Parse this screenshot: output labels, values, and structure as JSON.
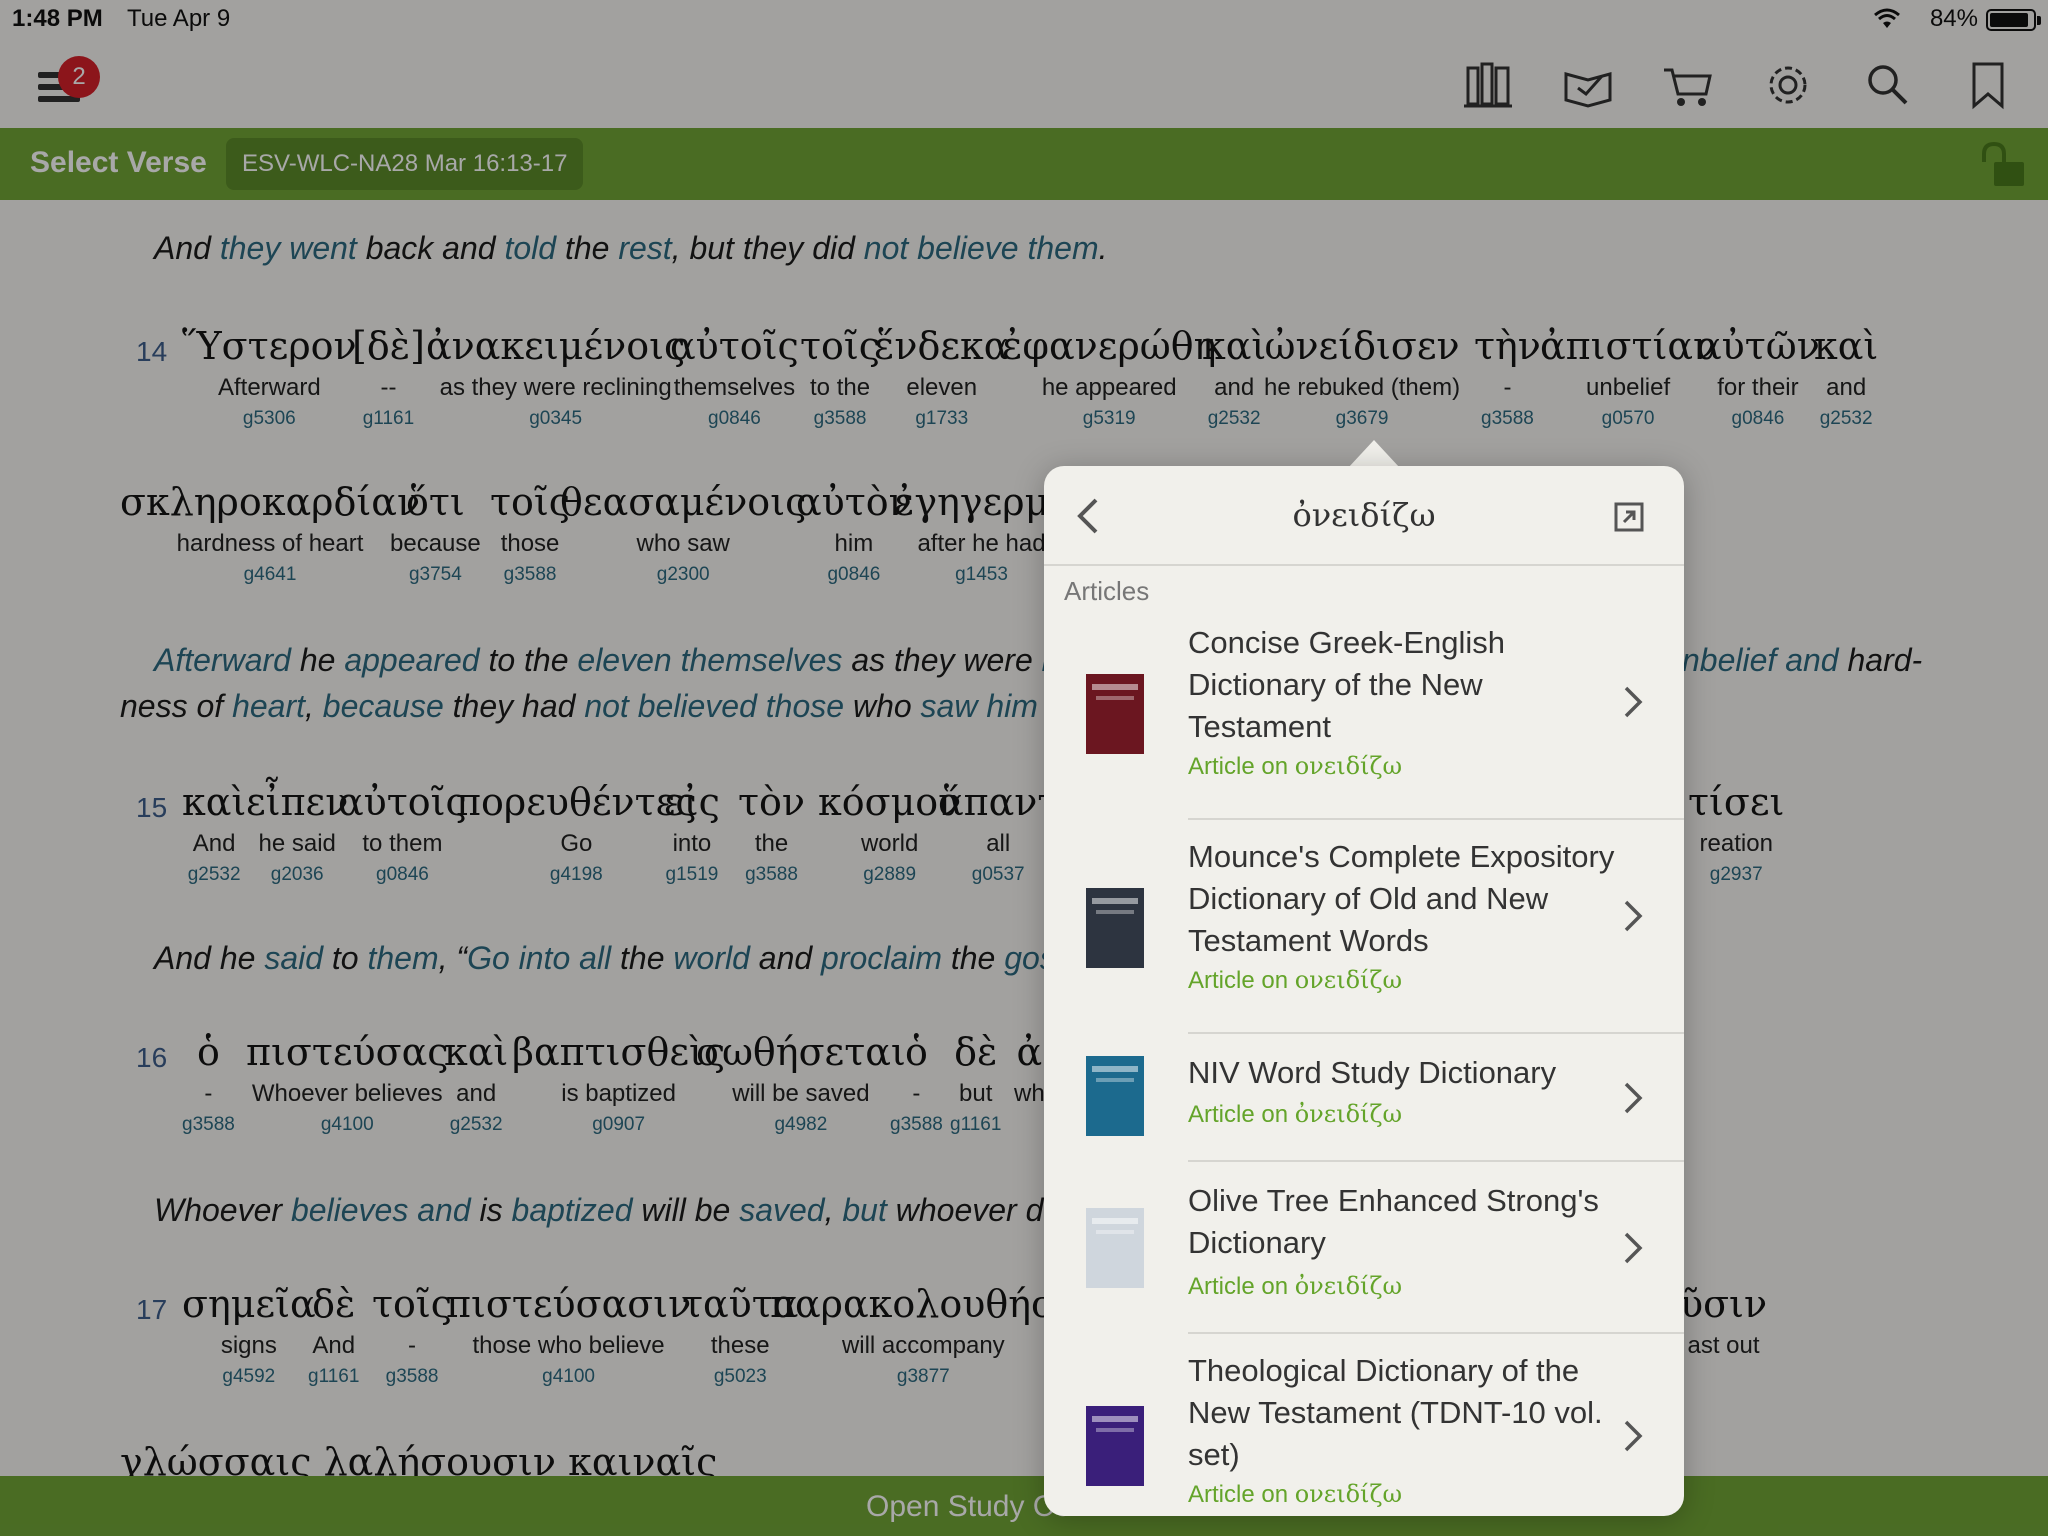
{
  "status": {
    "time": "1:48 PM",
    "date": "Tue Apr 9",
    "battery": "84%"
  },
  "toolbar": {
    "notification_count": "2"
  },
  "header": {
    "select_verse": "Select Verse",
    "reference": "ESV-WLC-NA28 Mar 16:13-17"
  },
  "bottom_bar": {
    "label": "Open Study Ce"
  },
  "passage": {
    "v13_english": [
      "And ",
      "they went",
      " back and ",
      "told",
      " the ",
      "rest",
      ", but they did ",
      "not believe them",
      "."
    ],
    "v14": {
      "num": "14",
      "row1": [
        {
          "g": "Ὕστερον",
          "t": "Afterward",
          "s": "g5306"
        },
        {
          "g": "[δὲ]",
          "t": "--",
          "s": "g1161"
        },
        {
          "g": "ἀνακειμένοις",
          "t": "as they were reclining",
          "s": "g0345"
        },
        {
          "g": "αὐτοῖς",
          "t": "themselves",
          "s": "g0846"
        },
        {
          "g": "τοῖς",
          "t": "to the",
          "s": "g3588"
        },
        {
          "g": "ἕνδεκα",
          "t": "eleven",
          "s": "g1733"
        },
        {
          "g": "ἐφανερώθη",
          "t": "he appeared",
          "s": "g5319"
        },
        {
          "g": "καὶ",
          "t": "and",
          "s": "g2532"
        },
        {
          "g": "ὠνείδισεν",
          "t": "he rebuked (them)",
          "s": "g3679"
        },
        {
          "g": "τὴν",
          "t": "-",
          "s": "g3588"
        },
        {
          "g": "ἀπιστίαν",
          "t": "unbelief",
          "s": "g0570"
        },
        {
          "g": "αὐτῶν",
          "t": "for their",
          "s": "g0846"
        },
        {
          "g": "καὶ",
          "t": "and",
          "s": "g2532"
        }
      ],
      "row2": [
        {
          "g": "σκληροκαρδίαν",
          "t": "hardness of heart",
          "s": "g4641"
        },
        {
          "g": "ὅτι",
          "t": "because",
          "s": "g3754"
        },
        {
          "g": "τοῖς",
          "t": "those",
          "s": "g3588"
        },
        {
          "g": "θεασαμένοις",
          "t": "who saw",
          "s": "g2300"
        },
        {
          "g": "αὐτὸν",
          "t": "him",
          "s": "g0846"
        },
        {
          "g": "ἐγηγερμέ",
          "t": "after he had",
          "s": "g1453"
        }
      ],
      "english_line1": [
        "Afterward",
        " he ",
        "appeared",
        " to the ",
        "eleven themselves",
        " as they were ",
        "rec"
      ],
      "english_line1_right": [
        "nbelief and",
        " hard-"
      ],
      "english_line2": [
        "ness of ",
        "heart",
        ", ",
        "because",
        " they had ",
        "not believed those",
        " who ",
        "saw him",
        " aft"
      ]
    },
    "v15": {
      "num": "15",
      "words": [
        {
          "g": "καὶ",
          "t": "And",
          "s": "g2532"
        },
        {
          "g": "εἶπεν",
          "t": "he said",
          "s": "g2036"
        },
        {
          "g": "αὐτοῖς",
          "t": "to them",
          "s": "g0846"
        },
        {
          "g": "πορευθέντες",
          "t": "Go",
          "s": "g4198"
        },
        {
          "g": "εἰς",
          "t": "into",
          "s": "g1519"
        },
        {
          "g": "τὸν",
          "t": "the",
          "s": "g3588"
        },
        {
          "g": "κόσμον",
          "t": "world",
          "s": "g2889"
        },
        {
          "g": "ἅπαντ",
          "t": "all",
          "s": "g0537"
        }
      ],
      "right_word": {
        "g": "τίσει",
        "t": "reation",
        "s": "g2937"
      },
      "english": [
        "And he ",
        "said",
        " to ",
        "them",
        ", “",
        "Go into all",
        " the ",
        "world",
        " and ",
        "proclaim",
        " the ",
        "gosp"
      ]
    },
    "v16": {
      "num": "16",
      "words": [
        {
          "g": "ὁ",
          "t": "-",
          "s": "g3588"
        },
        {
          "g": "πιστεύσας",
          "t": "Whoever believes",
          "s": "g4100"
        },
        {
          "g": "καὶ",
          "t": "and",
          "s": "g2532"
        },
        {
          "g": "βαπτισθεὶς",
          "t": "is baptized",
          "s": "g0907"
        },
        {
          "g": "σωθήσεται",
          "t": "will be saved",
          "s": "g4982"
        },
        {
          "g": "ὁ",
          "t": "-",
          "s": "g3588"
        },
        {
          "g": "δὲ",
          "t": "but",
          "s": "g1161"
        },
        {
          "g": "ἀ",
          "t": "wh",
          "s": ""
        }
      ],
      "english": [
        "Whoever ",
        "believes and",
        " is ",
        "baptized",
        " will be ",
        "saved",
        ", ",
        "but",
        " whoever does"
      ]
    },
    "v17": {
      "num": "17",
      "words": [
        {
          "g": "σημεῖα",
          "t": "signs",
          "s": "g4592"
        },
        {
          "g": "δὲ",
          "t": "And",
          "s": "g1161"
        },
        {
          "g": "τοῖς",
          "t": "-",
          "s": "g3588"
        },
        {
          "g": "πιστεύσασιν",
          "t": "those who believe",
          "s": "g4100"
        },
        {
          "g": "ταῦτα",
          "t": "these",
          "s": "g5023"
        },
        {
          "g": "παρακολουθήσε",
          "t": "will accompany",
          "s": "g3877"
        }
      ],
      "right_word": {
        "g": "ῦσιν",
        "t": "ast out",
        "s": ""
      },
      "next_line": "γλώσσαις λαλήσουσιν καιναῖς"
    }
  },
  "popover": {
    "title": "ὀνειδίζω",
    "section": "Articles",
    "articles": [
      {
        "title": "Concise Greek-English Dictionary of the New Testament",
        "sub_prefix": "Article on ",
        "sub_word": "ονειδίζω"
      },
      {
        "title": "Mounce's Complete Expository Dictionary of Old and New Testament Words",
        "sub_prefix": "Article on ",
        "sub_word": "ονειδίζω"
      },
      {
        "title": "NIV Word Study Dictionary",
        "sub_prefix": "Article on ",
        "sub_word": "ὀνειδίζω"
      },
      {
        "title": "Olive Tree Enhanced Strong's Dictionary",
        "sub_prefix": "Article on ",
        "sub_word": "ὀνειδίζω"
      },
      {
        "title": "Theological Dictionary of the New Testament (TDNT-10 vol. set)",
        "sub_prefix": "Article on ",
        "sub_word": "ονειδίζω"
      }
    ],
    "covers": [
      {
        "label": "Concise Greek-English Dictionary",
        "color": "#6b1620"
      },
      {
        "label": "MOUNCE'S DICTIONARY",
        "color": "#2d3440"
      },
      {
        "label": "NIV WORD STUDY DICTIONARY",
        "color": "#1c6a8e"
      },
      {
        "label": "Strong's Dictionary",
        "color": "#cfd6dd"
      },
      {
        "label": "TDNT",
        "color": "#3a1f7a"
      }
    ]
  },
  "colors": {
    "accent_green": "#71a436",
    "link_blue": "#2d6a80",
    "article_green": "#64a42a"
  }
}
